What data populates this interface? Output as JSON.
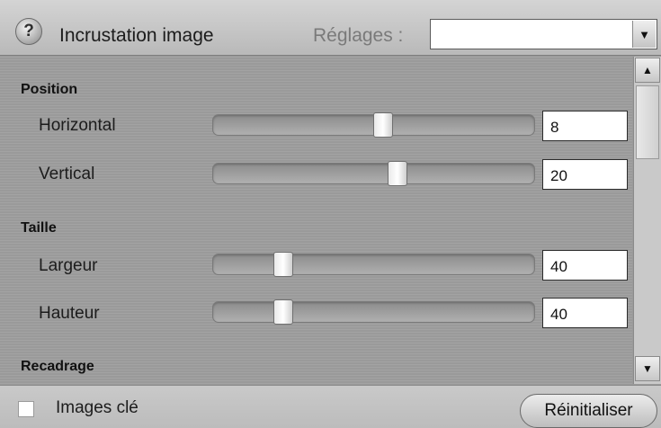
{
  "header": {
    "title": "Incrustation image",
    "presets_label": "Réglages :",
    "presets_value": "",
    "help_symbol": "?"
  },
  "sections": [
    {
      "title": "Position",
      "rows": [
        {
          "label": "Horizontal",
          "value": "8",
          "slider_level": 0.53
        },
        {
          "label": "Vertical",
          "value": "20",
          "slider_level": 0.58
        }
      ]
    },
    {
      "title": "Taille",
      "rows": [
        {
          "label": "Largeur",
          "value": "40",
          "slider_level": 0.2
        },
        {
          "label": "Hauteur",
          "value": "40",
          "slider_level": 0.2
        }
      ]
    },
    {
      "title": "Recadrage",
      "rows": []
    }
  ],
  "footer": {
    "keyframes_label": "Images clé",
    "keyframes_checked": false,
    "reset_label": "Réinitialiser"
  },
  "icons": {
    "help": "help-icon",
    "dropdown": "chevron-down-icon",
    "scroll_up": "arrow-up-icon",
    "scroll_down": "arrow-down-icon"
  }
}
